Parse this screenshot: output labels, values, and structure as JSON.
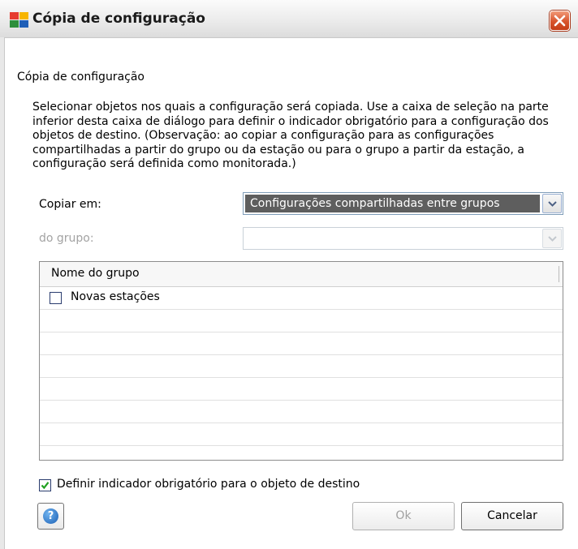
{
  "window": {
    "title": "Cópia de configuração",
    "icon": "avg-app-icon",
    "close_icon": "close-icon"
  },
  "section_title": "Cópia de configuração",
  "description": "Selecionar objetos nos quais a configuração será copiada. Use a caixa de seleção na parte inferior desta caixa de diálogo para definir o indicador obrigatório para a configuração dos objetos de destino. (Observação: ao copiar a configuração para as configurações compartilhadas a partir do grupo ou da estação ou para o grupo a partir da estação, a configuração será definida como monitorada.)",
  "copy_to": {
    "label": "Copiar em:",
    "selected": "Configurações compartilhadas entre grupos"
  },
  "from_group": {
    "label": "do grupo:",
    "selected": ""
  },
  "group_table": {
    "column_header": "Nome do grupo",
    "rows": [
      {
        "label": "Novas estações",
        "checked": false
      }
    ]
  },
  "mandatory_flag": {
    "label": "Definir indicador obrigatório para o objeto de destino",
    "checked": true
  },
  "buttons": {
    "ok": "Ok",
    "cancel": "Cancelar",
    "help_icon": "help-icon"
  },
  "colors": {
    "close_button": "#d8542c",
    "selection_highlight": "#5e5e5e",
    "check_mark": "#21a121"
  }
}
